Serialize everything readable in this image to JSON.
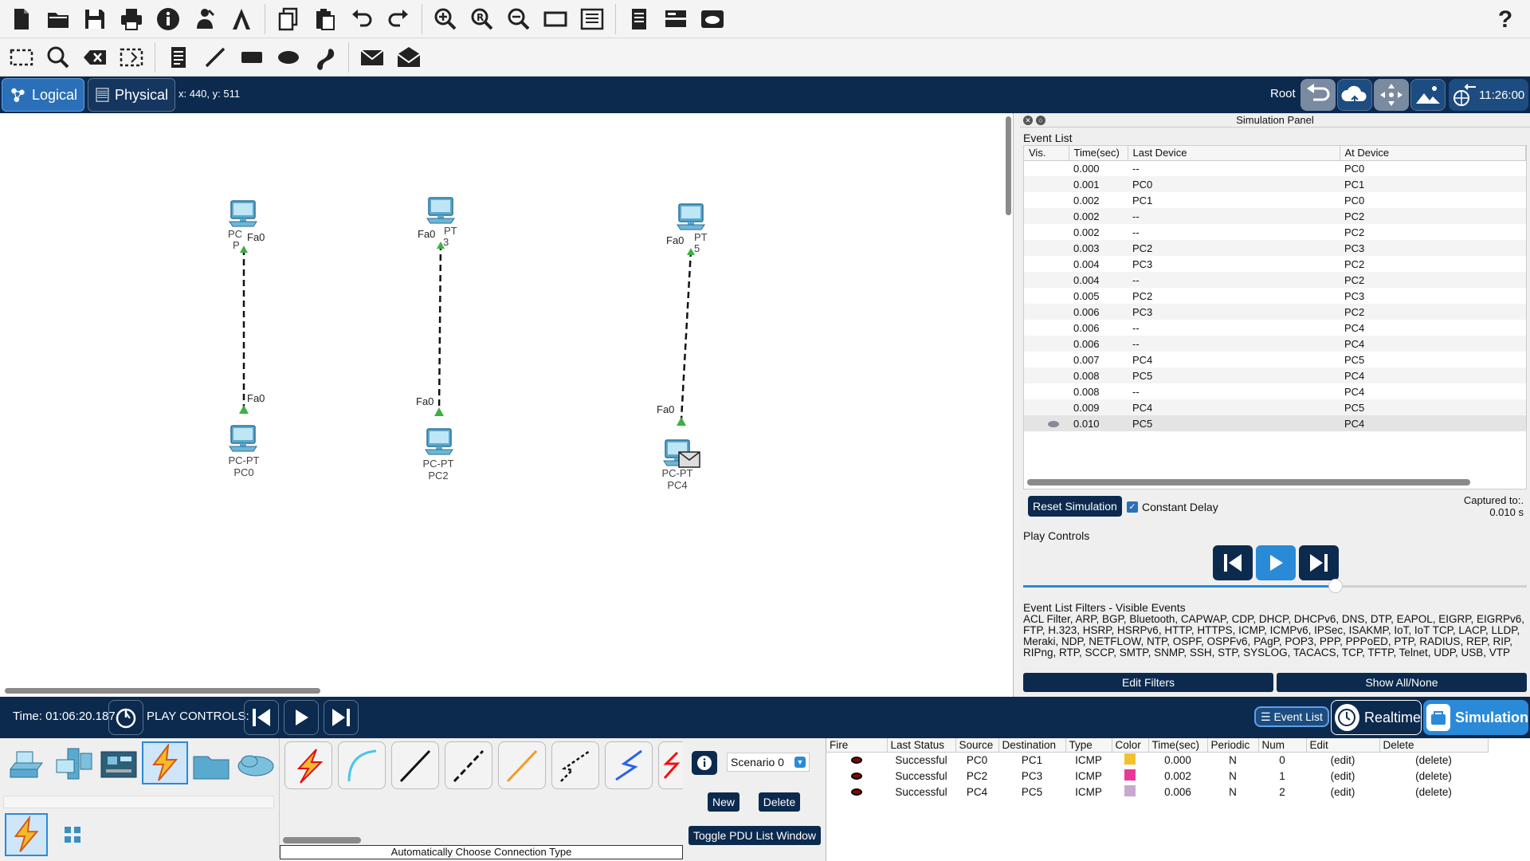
{
  "toolbar1": {
    "buttons": [
      "new-icon",
      "open-icon",
      "save-icon",
      "print-icon",
      "info-icon",
      "activity-wizard-icon",
      "custom-device-icon",
      "copy-icon",
      "paste-icon",
      "undo-icon",
      "redo-icon",
      "zoom-in-icon",
      "zoom-reset-icon",
      "zoom-out-icon",
      "drawing-palette-icon",
      "custom-device-dialog-icon",
      "pdu-list-icon",
      "device-panel-icon",
      "cloud-services-icon"
    ],
    "help": "?"
  },
  "toolbar2": {
    "buttons": [
      "select-icon",
      "inspect-icon",
      "delete-icon",
      "resize-icon",
      "note-icon",
      "line-icon",
      "rectangle-icon",
      "ellipse-icon",
      "freeform-icon",
      "add-simple-pdu-icon",
      "add-complex-pdu-icon"
    ]
  },
  "nav": {
    "logical": "Logical",
    "physical": "Physical",
    "coords": "x: 440, y: 511",
    "root": "Root",
    "time": "11:26:00"
  },
  "workspace": {
    "devices": [
      {
        "type": "PC-PT",
        "name": "PC0"
      },
      {
        "type": "PC-PT",
        "name": "PC1"
      },
      {
        "type": "PC-PT",
        "name": "PC2"
      },
      {
        "type": "PC-PT",
        "name": "PC3"
      },
      {
        "type": "PC-PT",
        "name": "PC4"
      },
      {
        "type": "PC-PT",
        "name": "PC5"
      }
    ],
    "top_labels": {
      "pc1_a": "PC",
      "pc1_b": "P",
      "pc3_a": "PT",
      "pc3_b": "3",
      "pc5_a": "PT",
      "pc5_b": "5"
    },
    "ports": {
      "pc1": "Fa0",
      "pc0": "Fa0",
      "pc3": "Fa0",
      "pc2": "Fa0",
      "pc5": "Fa0",
      "pc4": "Fa0"
    }
  },
  "sim_panel": {
    "title": "Simulation Panel",
    "event_list_title": "Event List",
    "columns": [
      "Vis.",
      "Time(sec)",
      "Last Device",
      "At Device"
    ],
    "events": [
      {
        "time": "0.000",
        "last": "--",
        "at": "PC0"
      },
      {
        "time": "0.001",
        "last": "PC0",
        "at": "PC1"
      },
      {
        "time": "0.002",
        "last": "PC1",
        "at": "PC0"
      },
      {
        "time": "0.002",
        "last": "--",
        "at": "PC2"
      },
      {
        "time": "0.002",
        "last": "--",
        "at": "PC2"
      },
      {
        "time": "0.003",
        "last": "PC2",
        "at": "PC3"
      },
      {
        "time": "0.004",
        "last": "PC3",
        "at": "PC2"
      },
      {
        "time": "0.004",
        "last": "--",
        "at": "PC2"
      },
      {
        "time": "0.005",
        "last": "PC2",
        "at": "PC3"
      },
      {
        "time": "0.006",
        "last": "PC3",
        "at": "PC2"
      },
      {
        "time": "0.006",
        "last": "--",
        "at": "PC4"
      },
      {
        "time": "0.006",
        "last": "--",
        "at": "PC4"
      },
      {
        "time": "0.007",
        "last": "PC4",
        "at": "PC5"
      },
      {
        "time": "0.008",
        "last": "PC5",
        "at": "PC4"
      },
      {
        "time": "0.008",
        "last": "--",
        "at": "PC4"
      },
      {
        "time": "0.009",
        "last": "PC4",
        "at": "PC5"
      },
      {
        "time": "0.010",
        "last": "PC5",
        "at": "PC4",
        "selected": true
      }
    ],
    "reset_label": "Reset Simulation",
    "constant_delay_label": "Constant Delay",
    "captured_label": "Captured to:.",
    "captured_value": "0.010 s",
    "play_controls_title": "Play Controls",
    "slider_fraction": 0.62,
    "filters_title": "Event List Filters - Visible Events",
    "filters_text": "ACL Filter, ARP, BGP, Bluetooth, CAPWAP, CDP, DHCP, DHCPv6, DNS, DTP, EAPOL, EIGRP, EIGRPv6, FTP, H.323, HSRP, HSRPv6, HTTP, HTTPS, ICMP, ICMPv6, IPSec, ISAKMP, IoT, IoT TCP, LACP, LLDP, Meraki, NDP, NETFLOW, NTP, OSPF, OSPFv6, PAgP, POP3, PPP, PPPoED, PTP, RADIUS, REP, RIP, RIPng, RTP, SCCP, SMTP, SNMP, SSH, STP, SYSLOG, TACACS, TCP, TFTP, Telnet, UDP, USB, VTP",
    "edit_filters": "Edit Filters",
    "show_all": "Show All/None"
  },
  "bottom": {
    "time": "Time: 01:06:20.187",
    "play_controls": "PLAY CONTROLS:",
    "event_list": "Event List",
    "realtime": "Realtime",
    "simulation": "Simulation"
  },
  "device_panel": {
    "connection_caption": "Automatically Choose Connection Type",
    "scenario": "Scenario 0",
    "new": "New",
    "delete": "Delete",
    "toggle_pdu": "Toggle PDU List Window",
    "pdu_columns": [
      "Fire",
      "Last Status",
      "Source",
      "Destination",
      "Type",
      "Color",
      "Time(sec)",
      "Periodic",
      "Num",
      "Edit",
      "Delete"
    ],
    "pdus": [
      {
        "status": "Successful",
        "source": "PC0",
        "dest": "PC1",
        "type": "ICMP",
        "color": "#f2c12e",
        "time": "0.000",
        "periodic": "N",
        "num": "0",
        "edit": "(edit)",
        "delete": "(delete)"
      },
      {
        "status": "Successful",
        "source": "PC2",
        "dest": "PC3",
        "type": "ICMP",
        "color": "#e8399a",
        "time": "0.002",
        "periodic": "N",
        "num": "1",
        "edit": "(edit)",
        "delete": "(delete)"
      },
      {
        "status": "Successful",
        "source": "PC4",
        "dest": "PC5",
        "type": "ICMP",
        "color": "#c8a8d0",
        "time": "0.006",
        "periodic": "N",
        "num": "2",
        "edit": "(edit)",
        "delete": "(delete)"
      }
    ]
  },
  "colors": {
    "navy": "#0b2a4e",
    "accent": "#2a8ad8",
    "link_green": "#3cb043"
  }
}
